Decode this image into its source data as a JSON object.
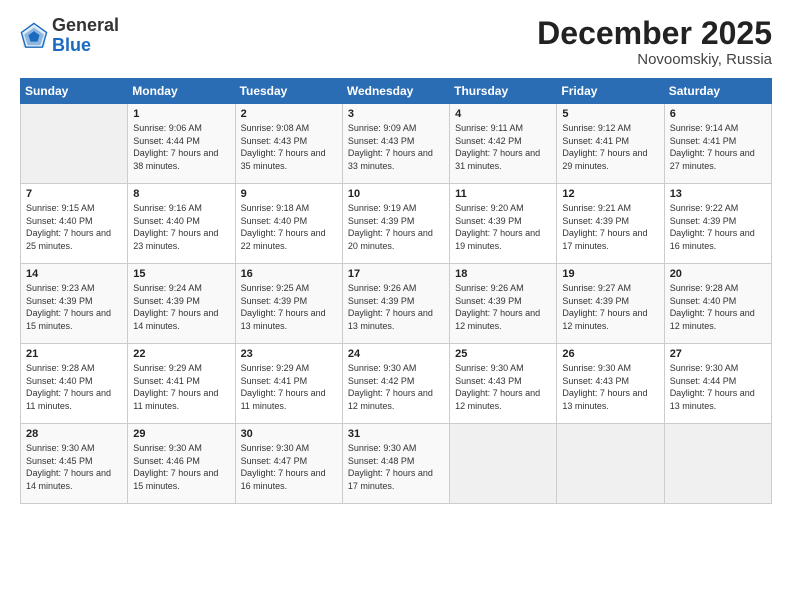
{
  "header": {
    "logo_general": "General",
    "logo_blue": "Blue",
    "month_title": "December 2025",
    "location": "Novoomskiy, Russia"
  },
  "weekdays": [
    "Sunday",
    "Monday",
    "Tuesday",
    "Wednesday",
    "Thursday",
    "Friday",
    "Saturday"
  ],
  "weeks": [
    [
      {
        "day": "",
        "sunrise": "",
        "sunset": "",
        "daylight": ""
      },
      {
        "day": "1",
        "sunrise": "Sunrise: 9:06 AM",
        "sunset": "Sunset: 4:44 PM",
        "daylight": "Daylight: 7 hours and 38 minutes."
      },
      {
        "day": "2",
        "sunrise": "Sunrise: 9:08 AM",
        "sunset": "Sunset: 4:43 PM",
        "daylight": "Daylight: 7 hours and 35 minutes."
      },
      {
        "day": "3",
        "sunrise": "Sunrise: 9:09 AM",
        "sunset": "Sunset: 4:43 PM",
        "daylight": "Daylight: 7 hours and 33 minutes."
      },
      {
        "day": "4",
        "sunrise": "Sunrise: 9:11 AM",
        "sunset": "Sunset: 4:42 PM",
        "daylight": "Daylight: 7 hours and 31 minutes."
      },
      {
        "day": "5",
        "sunrise": "Sunrise: 9:12 AM",
        "sunset": "Sunset: 4:41 PM",
        "daylight": "Daylight: 7 hours and 29 minutes."
      },
      {
        "day": "6",
        "sunrise": "Sunrise: 9:14 AM",
        "sunset": "Sunset: 4:41 PM",
        "daylight": "Daylight: 7 hours and 27 minutes."
      }
    ],
    [
      {
        "day": "7",
        "sunrise": "Sunrise: 9:15 AM",
        "sunset": "Sunset: 4:40 PM",
        "daylight": "Daylight: 7 hours and 25 minutes."
      },
      {
        "day": "8",
        "sunrise": "Sunrise: 9:16 AM",
        "sunset": "Sunset: 4:40 PM",
        "daylight": "Daylight: 7 hours and 23 minutes."
      },
      {
        "day": "9",
        "sunrise": "Sunrise: 9:18 AM",
        "sunset": "Sunset: 4:40 PM",
        "daylight": "Daylight: 7 hours and 22 minutes."
      },
      {
        "day": "10",
        "sunrise": "Sunrise: 9:19 AM",
        "sunset": "Sunset: 4:39 PM",
        "daylight": "Daylight: 7 hours and 20 minutes."
      },
      {
        "day": "11",
        "sunrise": "Sunrise: 9:20 AM",
        "sunset": "Sunset: 4:39 PM",
        "daylight": "Daylight: 7 hours and 19 minutes."
      },
      {
        "day": "12",
        "sunrise": "Sunrise: 9:21 AM",
        "sunset": "Sunset: 4:39 PM",
        "daylight": "Daylight: 7 hours and 17 minutes."
      },
      {
        "day": "13",
        "sunrise": "Sunrise: 9:22 AM",
        "sunset": "Sunset: 4:39 PM",
        "daylight": "Daylight: 7 hours and 16 minutes."
      }
    ],
    [
      {
        "day": "14",
        "sunrise": "Sunrise: 9:23 AM",
        "sunset": "Sunset: 4:39 PM",
        "daylight": "Daylight: 7 hours and 15 minutes."
      },
      {
        "day": "15",
        "sunrise": "Sunrise: 9:24 AM",
        "sunset": "Sunset: 4:39 PM",
        "daylight": "Daylight: 7 hours and 14 minutes."
      },
      {
        "day": "16",
        "sunrise": "Sunrise: 9:25 AM",
        "sunset": "Sunset: 4:39 PM",
        "daylight": "Daylight: 7 hours and 13 minutes."
      },
      {
        "day": "17",
        "sunrise": "Sunrise: 9:26 AM",
        "sunset": "Sunset: 4:39 PM",
        "daylight": "Daylight: 7 hours and 13 minutes."
      },
      {
        "day": "18",
        "sunrise": "Sunrise: 9:26 AM",
        "sunset": "Sunset: 4:39 PM",
        "daylight": "Daylight: 7 hours and 12 minutes."
      },
      {
        "day": "19",
        "sunrise": "Sunrise: 9:27 AM",
        "sunset": "Sunset: 4:39 PM",
        "daylight": "Daylight: 7 hours and 12 minutes."
      },
      {
        "day": "20",
        "sunrise": "Sunrise: 9:28 AM",
        "sunset": "Sunset: 4:40 PM",
        "daylight": "Daylight: 7 hours and 12 minutes."
      }
    ],
    [
      {
        "day": "21",
        "sunrise": "Sunrise: 9:28 AM",
        "sunset": "Sunset: 4:40 PM",
        "daylight": "Daylight: 7 hours and 11 minutes."
      },
      {
        "day": "22",
        "sunrise": "Sunrise: 9:29 AM",
        "sunset": "Sunset: 4:41 PM",
        "daylight": "Daylight: 7 hours and 11 minutes."
      },
      {
        "day": "23",
        "sunrise": "Sunrise: 9:29 AM",
        "sunset": "Sunset: 4:41 PM",
        "daylight": "Daylight: 7 hours and 11 minutes."
      },
      {
        "day": "24",
        "sunrise": "Sunrise: 9:30 AM",
        "sunset": "Sunset: 4:42 PM",
        "daylight": "Daylight: 7 hours and 12 minutes."
      },
      {
        "day": "25",
        "sunrise": "Sunrise: 9:30 AM",
        "sunset": "Sunset: 4:43 PM",
        "daylight": "Daylight: 7 hours and 12 minutes."
      },
      {
        "day": "26",
        "sunrise": "Sunrise: 9:30 AM",
        "sunset": "Sunset: 4:43 PM",
        "daylight": "Daylight: 7 hours and 13 minutes."
      },
      {
        "day": "27",
        "sunrise": "Sunrise: 9:30 AM",
        "sunset": "Sunset: 4:44 PM",
        "daylight": "Daylight: 7 hours and 13 minutes."
      }
    ],
    [
      {
        "day": "28",
        "sunrise": "Sunrise: 9:30 AM",
        "sunset": "Sunset: 4:45 PM",
        "daylight": "Daylight: 7 hours and 14 minutes."
      },
      {
        "day": "29",
        "sunrise": "Sunrise: 9:30 AM",
        "sunset": "Sunset: 4:46 PM",
        "daylight": "Daylight: 7 hours and 15 minutes."
      },
      {
        "day": "30",
        "sunrise": "Sunrise: 9:30 AM",
        "sunset": "Sunset: 4:47 PM",
        "daylight": "Daylight: 7 hours and 16 minutes."
      },
      {
        "day": "31",
        "sunrise": "Sunrise: 9:30 AM",
        "sunset": "Sunset: 4:48 PM",
        "daylight": "Daylight: 7 hours and 17 minutes."
      },
      {
        "day": "",
        "sunrise": "",
        "sunset": "",
        "daylight": ""
      },
      {
        "day": "",
        "sunrise": "",
        "sunset": "",
        "daylight": ""
      },
      {
        "day": "",
        "sunrise": "",
        "sunset": "",
        "daylight": ""
      }
    ]
  ]
}
